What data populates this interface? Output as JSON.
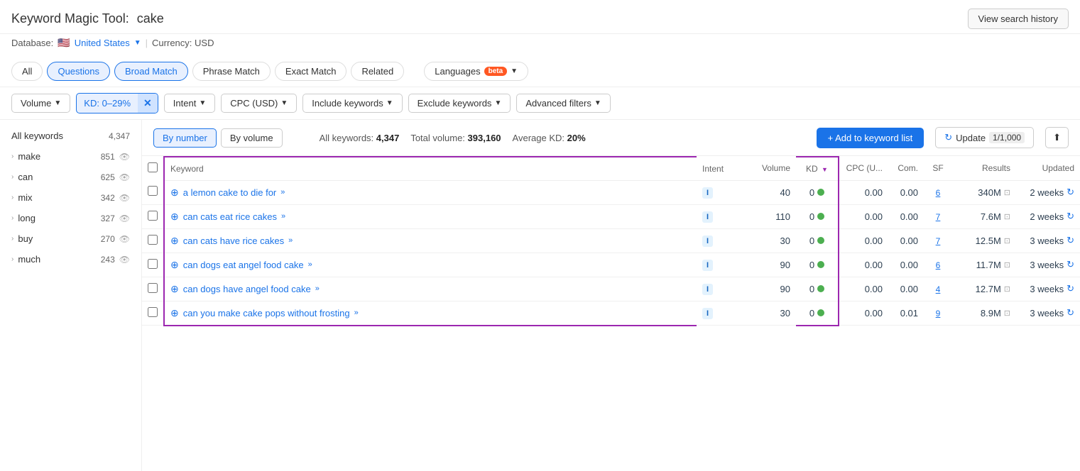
{
  "header": {
    "title_prefix": "Keyword Magic Tool:",
    "title_keyword": "cake",
    "view_history_label": "View search history"
  },
  "subtitle": {
    "database_label": "Database:",
    "country": "United States",
    "currency_label": "Currency: USD"
  },
  "tabs": [
    {
      "id": "all",
      "label": "All",
      "active": false
    },
    {
      "id": "questions",
      "label": "Questions",
      "active": false
    },
    {
      "id": "broad-match",
      "label": "Broad Match",
      "active": true
    },
    {
      "id": "phrase-match",
      "label": "Phrase Match",
      "active": false
    },
    {
      "id": "exact-match",
      "label": "Exact Match",
      "active": false
    },
    {
      "id": "related",
      "label": "Related",
      "active": false
    }
  ],
  "languages_label": "Languages",
  "beta_label": "beta",
  "filters": [
    {
      "id": "volume",
      "label": "Volume",
      "active": false
    },
    {
      "id": "kd",
      "label": "KD: 0–29%",
      "active": true,
      "has_x": true
    },
    {
      "id": "intent",
      "label": "Intent",
      "active": false
    },
    {
      "id": "cpc",
      "label": "CPC (USD)",
      "active": false
    },
    {
      "id": "include-keywords",
      "label": "Include keywords",
      "active": false
    },
    {
      "id": "exclude-keywords",
      "label": "Exclude keywords",
      "active": false
    },
    {
      "id": "advanced-filters",
      "label": "Advanced filters",
      "active": false
    }
  ],
  "sort_buttons": [
    {
      "id": "by-number",
      "label": "By number",
      "active": true
    },
    {
      "id": "by-volume",
      "label": "By volume",
      "active": false
    }
  ],
  "stats": {
    "all_keywords_label": "All keywords:",
    "all_keywords_value": "4,347",
    "total_volume_label": "Total volume:",
    "total_volume_value": "393,160",
    "average_kd_label": "Average KD:",
    "average_kd_value": "20%"
  },
  "add_keyword_label": "+ Add to keyword list",
  "update_label": "Update",
  "update_count": "1/1,000",
  "sidebar_items": [
    {
      "label": "All keywords",
      "count": "4,347",
      "is_all": true
    },
    {
      "label": "make",
      "count": "851"
    },
    {
      "label": "can",
      "count": "625"
    },
    {
      "label": "mix",
      "count": "342"
    },
    {
      "label": "long",
      "count": "327"
    },
    {
      "label": "buy",
      "count": "270"
    },
    {
      "label": "much",
      "count": "243"
    }
  ],
  "table": {
    "headers": [
      {
        "id": "checkbox",
        "label": ""
      },
      {
        "id": "keyword",
        "label": "Keyword"
      },
      {
        "id": "intent",
        "label": "Intent"
      },
      {
        "id": "volume",
        "label": "Volume"
      },
      {
        "id": "kd",
        "label": "KD"
      },
      {
        "id": "cpc",
        "label": "CPC (U..."
      },
      {
        "id": "com",
        "label": "Com."
      },
      {
        "id": "sf",
        "label": "SF"
      },
      {
        "id": "results",
        "label": "Results"
      },
      {
        "id": "updated",
        "label": "Updated"
      }
    ],
    "rows": [
      {
        "keyword": "a lemon cake to die for",
        "intent": "I",
        "volume": "40",
        "kd": "0",
        "kd_dot": true,
        "cpc": "0.00",
        "com": "0.00",
        "sf": "6",
        "results": "340M",
        "updated": "2 weeks"
      },
      {
        "keyword": "can cats eat rice cakes",
        "intent": "I",
        "volume": "110",
        "kd": "0",
        "kd_dot": true,
        "cpc": "0.00",
        "com": "0.00",
        "sf": "7",
        "results": "7.6M",
        "updated": "2 weeks"
      },
      {
        "keyword": "can cats have rice cakes",
        "intent": "I",
        "volume": "30",
        "kd": "0",
        "kd_dot": true,
        "cpc": "0.00",
        "com": "0.00",
        "sf": "7",
        "results": "12.5M",
        "updated": "3 weeks"
      },
      {
        "keyword": "can dogs eat angel food cake",
        "intent": "I",
        "volume": "90",
        "kd": "0",
        "kd_dot": true,
        "cpc": "0.00",
        "com": "0.00",
        "sf": "6",
        "results": "11.7M",
        "updated": "3 weeks"
      },
      {
        "keyword": "can dogs have angel food cake",
        "intent": "I",
        "volume": "90",
        "kd": "0",
        "kd_dot": true,
        "cpc": "0.00",
        "com": "0.00",
        "sf": "4",
        "results": "12.7M",
        "updated": "3 weeks"
      },
      {
        "keyword": "can you make cake pops without frosting",
        "intent": "I",
        "volume": "30",
        "kd": "0",
        "kd_dot": true,
        "cpc": "0.00",
        "com": "0.01",
        "sf": "9",
        "results": "8.9M",
        "updated": "3 weeks"
      }
    ]
  }
}
